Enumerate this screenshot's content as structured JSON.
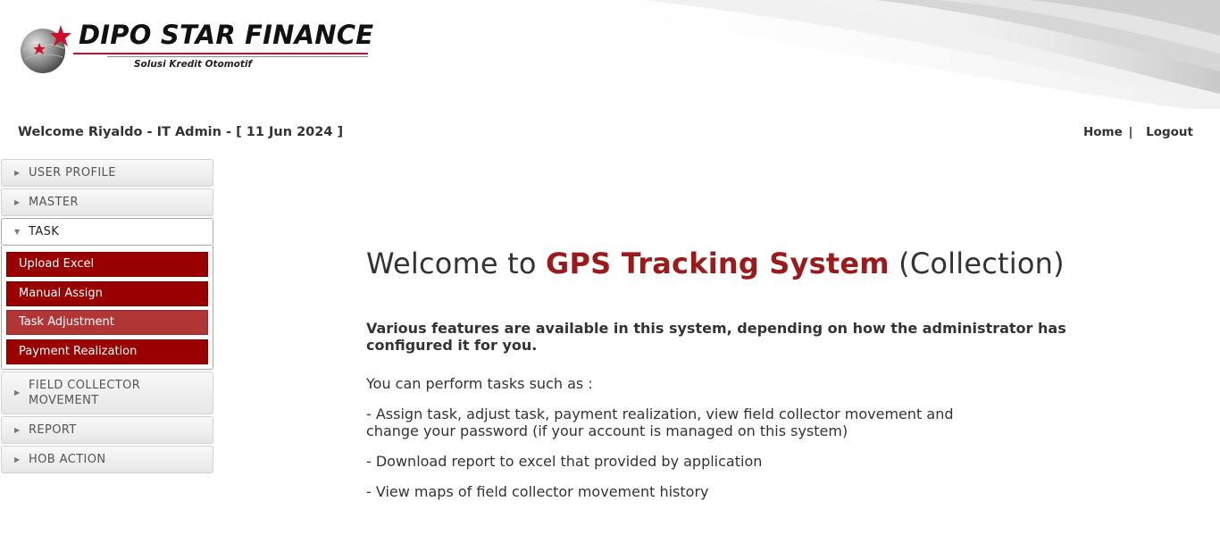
{
  "brand": {
    "name": "DIPO STAR FINANCE",
    "tagline": "Solusi Kredit Otomotif"
  },
  "welcome": "Welcome Riyaldo - IT Admin - [ 11 Jun 2024 ]",
  "nav": {
    "home": "Home",
    "separator": "|",
    "logout": "Logout"
  },
  "sidebar": {
    "user_profile": "USER PROFILE",
    "master": "MASTER",
    "task": "TASK",
    "task_items": [
      "Upload Excel",
      "Manual Assign",
      "Task Adjustment",
      "Payment Realization"
    ],
    "field_collector_line1": "FIELD COLLECTOR",
    "field_collector_line2": "MOVEMENT",
    "report": "REPORT",
    "hob_action": "HOB ACTION"
  },
  "main": {
    "title_prefix": "Welcome to ",
    "title_accent": "GPS Tracking System",
    "title_suffix": " (Collection)",
    "lead": "Various features are available in this system, depending on how the administrator has configured it for you.",
    "intro": "You can perform tasks such as :",
    "feature_1": "- Assign task, adjust task, payment realization, view field collector movement and change your password (if your account is managed on this system)",
    "feature_2": "- Download report to excel that provided by application",
    "feature_3": "- View maps of field collector movement history"
  },
  "colors": {
    "accent": "#9b1b1b",
    "submenu_bg": "#990000",
    "submenu_hover": "#b03535"
  }
}
